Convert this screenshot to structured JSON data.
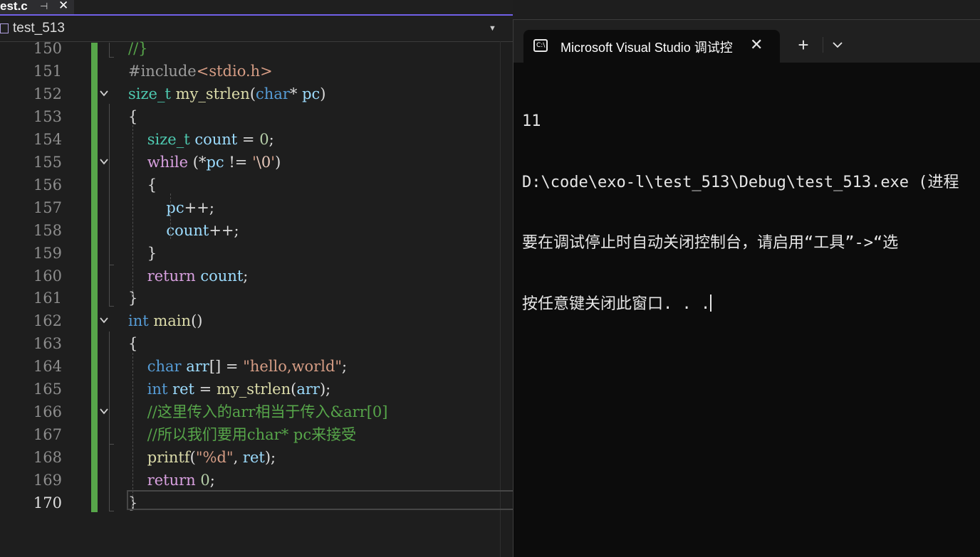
{
  "editor": {
    "tab_label": "est.c",
    "pin_icon": "pin-icon",
    "close_icon": "close-icon",
    "nav_label": "test_513",
    "lines": [
      {
        "n": "150",
        "tokens": [
          [
            "cmt",
            "//}"
          ]
        ]
      },
      {
        "n": "151",
        "tokens": [
          [
            "pre",
            "#include"
          ],
          [
            "str",
            "<stdio.h>"
          ]
        ]
      },
      {
        "n": "152",
        "tokens": [
          [
            "ty",
            "size_t"
          ],
          [
            "plain",
            " "
          ],
          [
            "fn",
            "my_strlen"
          ],
          [
            "plain",
            "("
          ],
          [
            "kw",
            "char"
          ],
          [
            "plain",
            "* "
          ],
          [
            "var",
            "pc"
          ],
          [
            "plain",
            ")"
          ]
        ]
      },
      {
        "n": "153",
        "tokens": [
          [
            "plain",
            "{"
          ]
        ]
      },
      {
        "n": "154",
        "tokens": [
          [
            "plain",
            "    "
          ],
          [
            "ty",
            "size_t"
          ],
          [
            "plain",
            " "
          ],
          [
            "var",
            "count"
          ],
          [
            "plain",
            " = "
          ],
          [
            "num",
            "0"
          ],
          [
            "plain",
            ";"
          ]
        ]
      },
      {
        "n": "155",
        "tokens": [
          [
            "plain",
            "    "
          ],
          [
            "ctl",
            "while"
          ],
          [
            "plain",
            " (*"
          ],
          [
            "var",
            "pc"
          ],
          [
            "plain",
            " != "
          ],
          [
            "str",
            "'"
          ],
          [
            "esc",
            "\\0"
          ],
          [
            "str",
            "'"
          ],
          [
            "plain",
            ")"
          ]
        ]
      },
      {
        "n": "156",
        "tokens": [
          [
            "plain",
            "    {"
          ]
        ]
      },
      {
        "n": "157",
        "tokens": [
          [
            "plain",
            "        "
          ],
          [
            "var",
            "pc"
          ],
          [
            "plain",
            "++;"
          ]
        ]
      },
      {
        "n": "158",
        "tokens": [
          [
            "plain",
            "        "
          ],
          [
            "var",
            "count"
          ],
          [
            "plain",
            "++;"
          ]
        ]
      },
      {
        "n": "159",
        "tokens": [
          [
            "plain",
            "    }"
          ]
        ]
      },
      {
        "n": "160",
        "tokens": [
          [
            "plain",
            "    "
          ],
          [
            "ctl",
            "return"
          ],
          [
            "plain",
            " "
          ],
          [
            "var",
            "count"
          ],
          [
            "plain",
            ";"
          ]
        ]
      },
      {
        "n": "161",
        "tokens": [
          [
            "plain",
            "}"
          ]
        ]
      },
      {
        "n": "162",
        "tokens": [
          [
            "kw",
            "int"
          ],
          [
            "plain",
            " "
          ],
          [
            "fn",
            "main"
          ],
          [
            "plain",
            "()"
          ]
        ]
      },
      {
        "n": "163",
        "tokens": [
          [
            "plain",
            "{"
          ]
        ]
      },
      {
        "n": "164",
        "tokens": [
          [
            "plain",
            "    "
          ],
          [
            "kw",
            "char"
          ],
          [
            "plain",
            " "
          ],
          [
            "var",
            "arr"
          ],
          [
            "plain",
            "[] = "
          ],
          [
            "str",
            "\"hello,world\""
          ],
          [
            "plain",
            ";"
          ]
        ]
      },
      {
        "n": "165",
        "tokens": [
          [
            "plain",
            "    "
          ],
          [
            "kw",
            "int"
          ],
          [
            "plain",
            " "
          ],
          [
            "var",
            "ret"
          ],
          [
            "plain",
            " = "
          ],
          [
            "fn",
            "my_strlen"
          ],
          [
            "plain",
            "("
          ],
          [
            "var",
            "arr"
          ],
          [
            "plain",
            ");"
          ]
        ]
      },
      {
        "n": "166",
        "tokens": [
          [
            "plain",
            "    "
          ],
          [
            "cmt",
            "//这里传入的arr相当于传入&arr[0]"
          ]
        ]
      },
      {
        "n": "167",
        "tokens": [
          [
            "plain",
            "    "
          ],
          [
            "cmt",
            "//所以我们要用char* pc来接受"
          ]
        ]
      },
      {
        "n": "168",
        "tokens": [
          [
            "plain",
            "    "
          ],
          [
            "fn",
            "printf"
          ],
          [
            "plain",
            "("
          ],
          [
            "str",
            "\"%d\""
          ],
          [
            "plain",
            ", "
          ],
          [
            "var",
            "ret"
          ],
          [
            "plain",
            ");"
          ]
        ]
      },
      {
        "n": "169",
        "tokens": [
          [
            "plain",
            "    "
          ],
          [
            "ctl",
            "return"
          ],
          [
            "plain",
            " "
          ],
          [
            "num",
            "0"
          ],
          [
            "plain",
            ";"
          ]
        ]
      },
      {
        "n": "170",
        "tokens": [
          [
            "plain",
            "}"
          ]
        ]
      }
    ],
    "fold_lines": [
      "152",
      "155",
      "162",
      "166"
    ]
  },
  "terminal": {
    "tab_title": "Microsoft Visual Studio 调试控",
    "tab_icon": "cmd-icon",
    "new_tab": "+",
    "output": [
      "11",
      "D:\\code\\exo-l\\test_513\\Debug\\test_513.exe (进程",
      "要在调试停止时自动关闭控制台，请启用“工具”->“选",
      "按任意键关闭此窗口. . ."
    ]
  }
}
